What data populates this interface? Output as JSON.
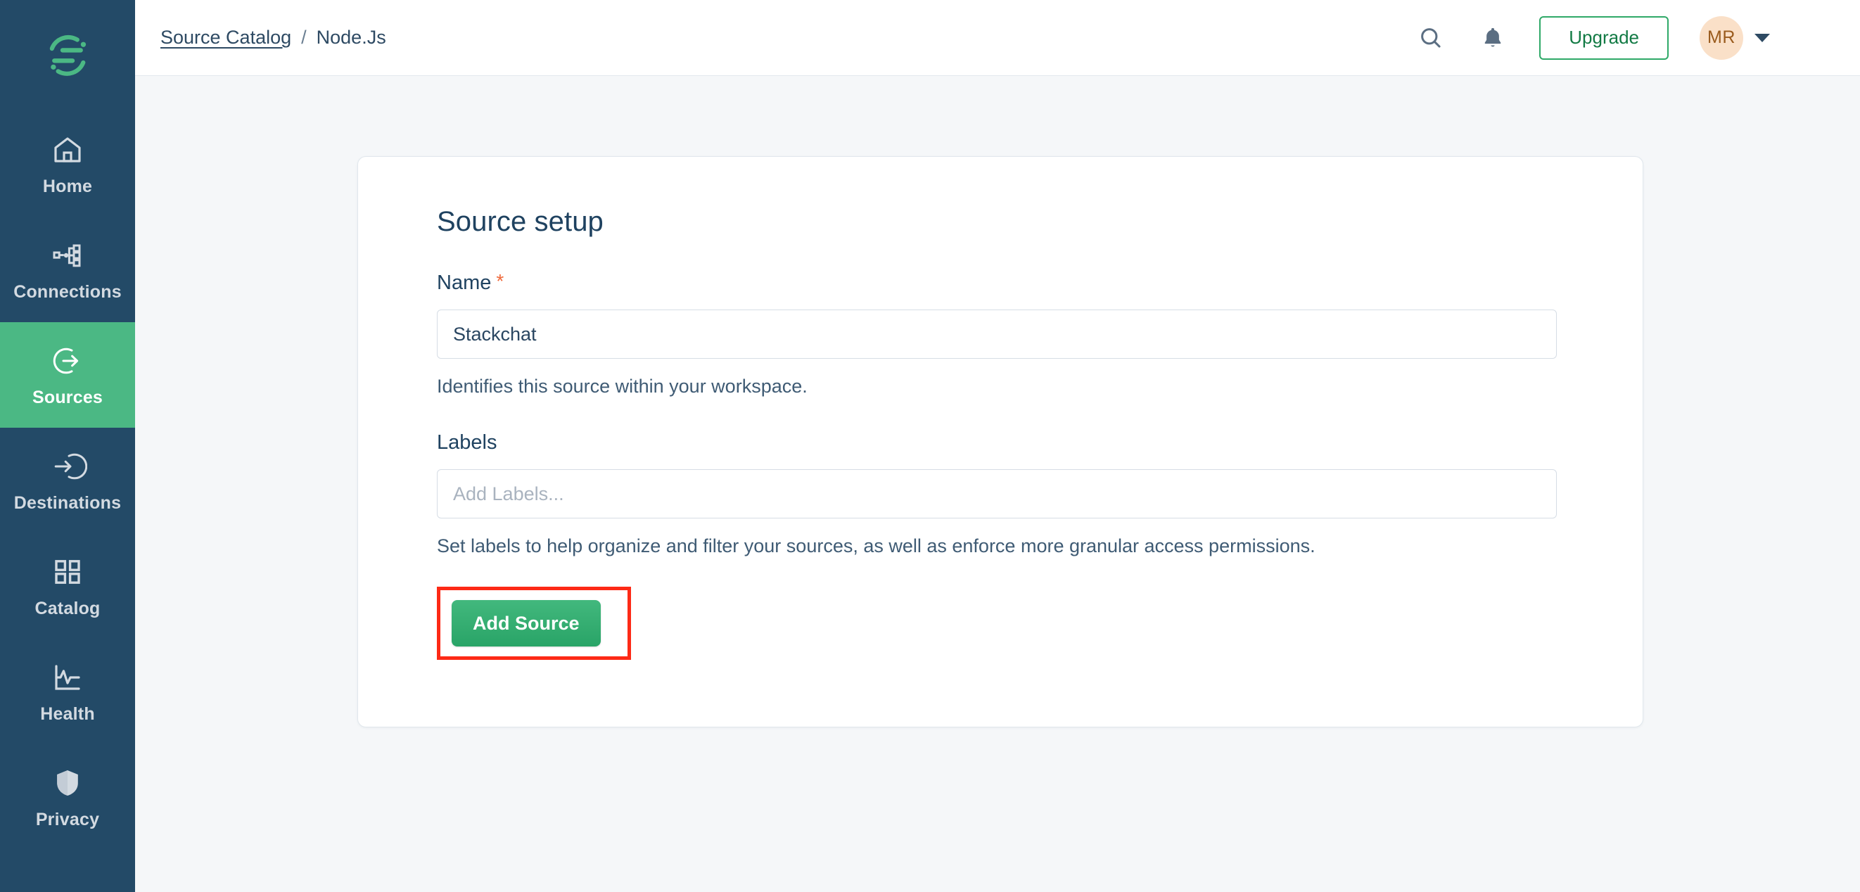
{
  "sidebar": {
    "logo_name": "stackchat-logo",
    "accent_green": "#4BB884",
    "background": "#234A67",
    "items": [
      {
        "label": "Home",
        "icon": "home-icon",
        "active": false
      },
      {
        "label": "Connections",
        "icon": "connections-icon",
        "active": false
      },
      {
        "label": "Sources",
        "icon": "sources-arrow-out-icon",
        "active": true
      },
      {
        "label": "Destinations",
        "icon": "destinations-arrow-in-icon",
        "active": false
      },
      {
        "label": "Catalog",
        "icon": "catalog-grid-icon",
        "active": false
      },
      {
        "label": "Health",
        "icon": "health-chart-icon",
        "active": false
      },
      {
        "label": "Privacy",
        "icon": "privacy-shield-icon",
        "active": false
      }
    ]
  },
  "topbar": {
    "breadcrumb": {
      "parent": "Source Catalog",
      "separator": "/",
      "current": "Node.Js"
    },
    "search_icon": "search-icon",
    "notifications_icon": "bell-icon",
    "upgrade_label": "Upgrade",
    "upgrade_border_color": "#2FA968",
    "avatar_initials": "MR",
    "avatar_bg": "#FAE0C8",
    "avatar_text_color": "#9A5B1D"
  },
  "card": {
    "title": "Source setup",
    "name_field": {
      "label": "Name",
      "required_marker": "*",
      "value": "Stackchat",
      "placeholder": "",
      "help": "Identifies this source within your workspace."
    },
    "labels_field": {
      "label": "Labels",
      "value": "",
      "placeholder": "Add Labels...",
      "help": "Set labels to help organize and filter your sources, as well as enforce more granular access permissions."
    },
    "submit": {
      "label": "Add Source",
      "color": "#2FA86A",
      "highlight_color": "#FD2A16"
    }
  }
}
